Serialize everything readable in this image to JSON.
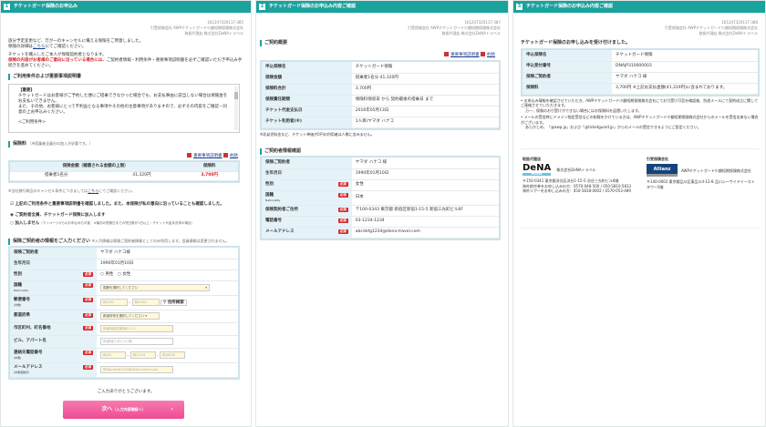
{
  "colors": {
    "header": "#1aa29c",
    "required": "#d9262c",
    "button": "#f0529a"
  },
  "panel1": {
    "step": "1",
    "title": "チケットガード保険のお申込み",
    "meta": [
      "161247320117-385",
      "引受保険会社 AWPチケットガード少額短期保険株式会社",
      "取扱代理店 株式会社DeNAトラベル"
    ],
    "intro1": "旅分予定変更など、万が一のキャンセルに備える保険をご用意しました。",
    "intro2a": "保険の詳細は",
    "intro2link": "こちら",
    "intro2b": "にてご確認ください。",
    "intro3": "チケットを購入したご本人が保険契約者となります。",
    "intro4red": "保険の内容がお客様のご意向に沿っている場合には、",
    "intro4": "ご契約者情報・利用条件・重要事項説明書を必ずご確認いただき申込み手続きを進めてください。",
    "terms_title": "ご利用条件および重要事項説明書",
    "terms_lines": [
      "【重要】",
      "チケットガードはお客様がご予約した便にご搭乗できなかった場合でも、お支払事由に該当しない場合は保険金をお支払いできません。",
      "また、その他、お客様にとって不利益となる事項やその他の注意事項がありますので、必ずその内容をご確認・同意の上お申込みください。",
      "",
      "<ご利用条件>"
    ],
    "premium_title": "保険料",
    "premium_note": "（※搭乗者全員分の加入が必要です。）",
    "link_important": "重要事項説明書",
    "link_terms": "約款",
    "premium_headers": [
      "保険金額（補償される金額の上限）",
      "保険料"
    ],
    "premium_row": [
      "搭乗者1名分",
      "41,320円",
      "3,700円"
    ],
    "cancel_note": "※当社旅行商品のキャンセル条件につきましては",
    "cancel_link": "こちら",
    "cancel_note2": "にてご確認ください。",
    "agree_label": "上記のご利用条件と重要事項説明書を確認しました。また、本保険が私の意向に沿っていることも確認しました。",
    "radio_join": "ご契約者全員、チケットガード保険に加入します",
    "radio_decline": "加入しません",
    "radio_decline_note": "（マイページからのお申込みも可能　※最初の搭乗日までの残日数が1日以上・チケット代金未決済の場合）",
    "form_title": "保険ご契約者の情報をご入力ください",
    "form_note": "※入力情報は保険ご契約者情報としてのみ利用します。会員情報は変更されません。",
    "required": "必須",
    "form": [
      {
        "label": "保険ご契約者",
        "value": "ヤマダ ハナコ様"
      },
      {
        "label": "生年月日",
        "value": "1990年01月10日"
      },
      {
        "label": "性別",
        "male": "男性",
        "female": "女性"
      },
      {
        "label": "国籍",
        "sub": "Nationality",
        "select": "国籍を選択してください"
      },
      {
        "label": "郵便番号",
        "sub": "(半角)",
        "ph1": "例)100",
        "ph2": "例)0001",
        "search": "住所検索"
      },
      {
        "label": "都道府県",
        "select": "都道府県を選択してください"
      },
      {
        "label": "市区町村、町名番地",
        "ph": "例)新宿区西新宿1-1-1"
      },
      {
        "label": "ビル、アパート名",
        "ph": "例)新宿三井ビル1階"
      },
      {
        "label": "連絡先電話番号",
        "sub": "(半角)",
        "ph1": "例)03",
        "ph2": "例)1234",
        "ph3": "例)5678"
      },
      {
        "label": "メールアドレス",
        "sub": "(半角英数字)",
        "ph": "例)abcdefg1234@dena-travel.com"
      }
    ],
    "thanks": "ご入力ありがとうございます。",
    "next_label": "次へ",
    "next_sub": "（入力内容確認へ）"
  },
  "panel2": {
    "step": "2",
    "title": "チケットガード保険のお申込み内容ご確認",
    "meta": [
      "161247320117-387",
      "引受保険会社 AWPチケットガード少額短期保険株式会社",
      "取扱代理店 株式会社DeNAトラベル"
    ],
    "summary_title": "ご契約概要",
    "link_important": "重要事項説明書",
    "link_terms": "約款",
    "summary": [
      [
        "申込保険名",
        "チケットガード保険"
      ],
      [
        "保険金額",
        "搭乗者1名分 41,320円"
      ],
      [
        "保険料合計",
        "3,700円"
      ],
      [
        "保険責任期間",
        "保険料領収日 から 契約最後の搭乗日 まで"
      ],
      [
        "チケット代金支払日",
        "2016年05月13日"
      ],
      [
        "チケット利用者(※)",
        "1人目)ヤマダ ハナコ"
      ]
    ],
    "summary_note": "※乳幼児料金など、チケット単価が0円の利用者は人数に含みません。",
    "holder_title": "ご契約者情報確認",
    "holder": [
      [
        "保険ご契約者",
        "ヤマダ ハナコ 様",
        false,
        ""
      ],
      [
        "生年月日",
        "1990年01月10日",
        false,
        ""
      ],
      [
        "性別",
        "女性",
        true,
        ""
      ],
      [
        "国籍",
        "日本",
        true,
        "Nationality"
      ],
      [
        "保険契約者ご住所",
        "〒100-0343 東京都 新宿区新宿1-15-5 新宿三光町ビル6F",
        true,
        ""
      ],
      [
        "電話番号",
        "03-1234-1234",
        true,
        ""
      ],
      [
        "メールアドレス",
        "abcdefg1234@dena-travel.com",
        true,
        ""
      ]
    ],
    "required": "必須"
  },
  "panel3": {
    "step": "3",
    "title": "チケットガード保険のお申込み内容ご確認",
    "meta": [
      "161247320117-388",
      "引受保険会社 AWPチケットガード少額短期保険株式会社",
      "取扱代理店 株式会社DeNAトラベル"
    ],
    "done": "チケットガード保険のお申し込みを受け付けました。",
    "rows": [
      [
        "申込保険名",
        "チケットガード保険"
      ],
      [
        "申込受付番号",
        "DNAJP310000003"
      ],
      [
        "保険ご契約者",
        "ヤマダ ハナコ 様"
      ],
      [
        "保険料",
        "3,700円 ※上記お支払金額(41,319円)に含まれております。"
      ]
    ],
    "bullet1": "お申込み情報を確認させていただき、AWPチケットガード少額短期保険株式会社にてお引受け可否を確認後、別途メールにて契約成立に関してご連絡させていただきます。",
    "bullet1b": "万一、保険のお引受けができない場合にはお保険料を返還いたします。",
    "bullet2": "メールの受信時にドメイン指定受信などの制限をかけている方は、AWPチケットガード少額短期保険株式会社からのメールを受信出来ない場合がございます。",
    "bullet2b": "あらかじめ、「@awp.jp」および「@ticketguard.jp」からのメールの受信できるようにご設定ください。",
    "agent_title": "取扱代理店",
    "agent_name": "株式会社DeNAトラベル",
    "agent_logo": "DeNA",
    "agent_logo_sub": "TRAVEL",
    "agent_addr": "〒150-0341 東京都渋谷区渋谷1-15-5 渋谷三光町ビル6階",
    "agent_tel1": "海外航空券をお申し込みの方：0570-048-500 / 050-5810-5813",
    "agent_tel2": "海外ツアーをお申し込みの方：050-5818-0002 / 0570-053-489",
    "insurer_title": "引受保険会社",
    "insurer_name": "AWPチケットガード少額短期保険株式会社",
    "insurer_logo": "Allianz",
    "insurer_addr": "〒140-0002 東京都品川区東品川4-12-8 品川シーサイドイーストタワー5階"
  }
}
